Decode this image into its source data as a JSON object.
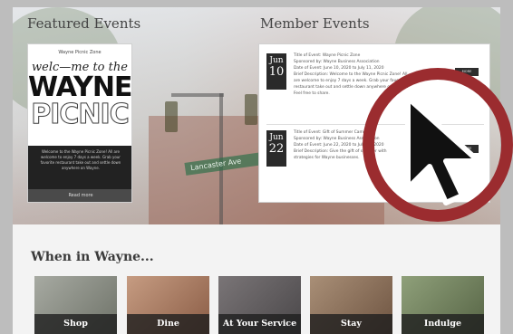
{
  "featured": {
    "title": "Featured Events",
    "poster": {
      "small_heading": "Wayne Picnic Zone",
      "line1": "welc—me to the",
      "line2": "WAYNE",
      "line3": "PICNIC",
      "blurb": "Welcome to the Wayne Picnic Zone! All are welcome to enjoy 7 days a week. Grab your favorite restaurant take out and settle down anywhere on Wayne.",
      "more_label": "Read more"
    }
  },
  "member": {
    "title": "Member Events",
    "events": [
      {
        "month": "Jun",
        "day": "10",
        "lines": [
          "Title of Event: Wayne Picnic Zone",
          "Sponsored by: Wayne Business Association",
          "Date of Event: June 10, 2020 to July 11, 2020",
          "Brief Description: Welcome to the Wayne Picnic Zone! All",
          "are welcome to enjoy 7 days a week. Grab your favorite",
          "restaurant take out and settle down anywhere on Wayne.",
          "Feel free to share."
        ],
        "button": "MORE"
      },
      {
        "month": "Jun",
        "day": "22",
        "lines": [
          "Title of Event: Gift of Summer Campaign",
          "Sponsored by: Wayne Business Association",
          "Date of Event: June 22, 2020 to July 31, 2020",
          "Brief Description: Give the gift of summer with",
          "strategies for Wayne businesses."
        ],
        "button": "MORE"
      }
    ]
  },
  "when": {
    "title": "When in Wayne...",
    "tiles": [
      {
        "label": "Shop",
        "color": "#8a8f86"
      },
      {
        "label": "Dine",
        "color": "#a3755d"
      },
      {
        "label": "At Your Service",
        "color": "#5e5b5d"
      },
      {
        "label": "Stay",
        "color": "#8c6e55"
      },
      {
        "label": "Indulge",
        "color": "#6f7f5a"
      }
    ]
  },
  "colors": {
    "accent_ring": "#9b2c2f",
    "date_box": "#2a2a2a"
  },
  "icons": {
    "cursor": "arrow-cursor-icon"
  },
  "street_sign": "Lancaster Ave"
}
